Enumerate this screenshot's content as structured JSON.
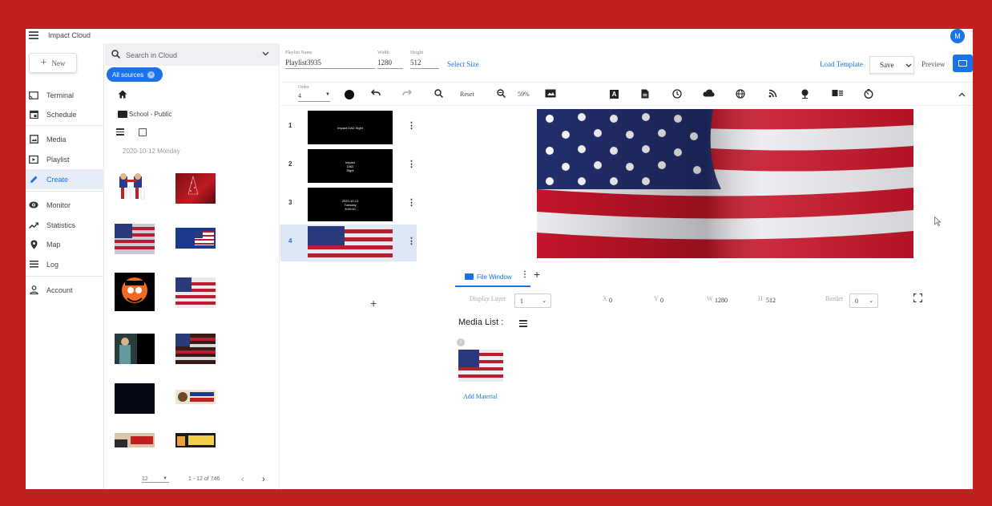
{
  "app": {
    "title": "Impact Cloud",
    "user_initial": "M"
  },
  "sidebar": {
    "new_label": "New",
    "items": [
      {
        "label": "Terminal",
        "icon": "cast-icon"
      },
      {
        "label": "Schedule",
        "icon": "calendar-icon"
      },
      {
        "label": "Media",
        "icon": "image-icon"
      },
      {
        "label": "Playlist",
        "icon": "playlist-icon"
      },
      {
        "label": "Create",
        "icon": "pencil-icon"
      },
      {
        "label": "Monitor",
        "icon": "eye-icon"
      },
      {
        "label": "Statistics",
        "icon": "trend-icon"
      },
      {
        "label": "Map",
        "icon": "pin-icon"
      },
      {
        "label": "Log",
        "icon": "list-icon"
      },
      {
        "label": "Account",
        "icon": "person-icon"
      }
    ],
    "active": "Create"
  },
  "library": {
    "search_placeholder": "Search in Cloud",
    "filter_chip": "All sources",
    "folder": "School - Public",
    "date_label": "2020-10-12 Monday",
    "page_size": "12",
    "range": "1 - 12 of 746"
  },
  "editor": {
    "playlist_name_label": "Playlist Name",
    "playlist_name": "Playlist3935",
    "width_label": "Width",
    "width": "1280",
    "height_label": "Height",
    "height": "512",
    "select_size": "Select Size",
    "load_template": "Load Template",
    "save": "Save",
    "preview": "Preview",
    "order_label": "Order",
    "order_value": "4",
    "reset": "Reset",
    "zoom": "59%",
    "slides": [
      {
        "num": "1",
        "text": "Impact DAD Sight"
      },
      {
        "num": "2",
        "text": "Impact\nDAD\nSight"
      },
      {
        "num": "3",
        "text": "2020-10-13\nTuesday\n8:00:00"
      },
      {
        "num": "4",
        "text": ""
      }
    ],
    "tab_label": "File Window",
    "display_layer_label": "Display Layer",
    "display_layer": "1",
    "x_label": "X",
    "x": "0",
    "y_label": "Y",
    "y": "0",
    "w_label": "W",
    "w": "1280",
    "h_label": "H",
    "h": "512",
    "border_label": "Border",
    "border": "0",
    "media_list_label": "Media List :",
    "add_material": "Add Material"
  },
  "colors": {
    "accent": "#1a73e8",
    "frame": "#c0201f"
  }
}
